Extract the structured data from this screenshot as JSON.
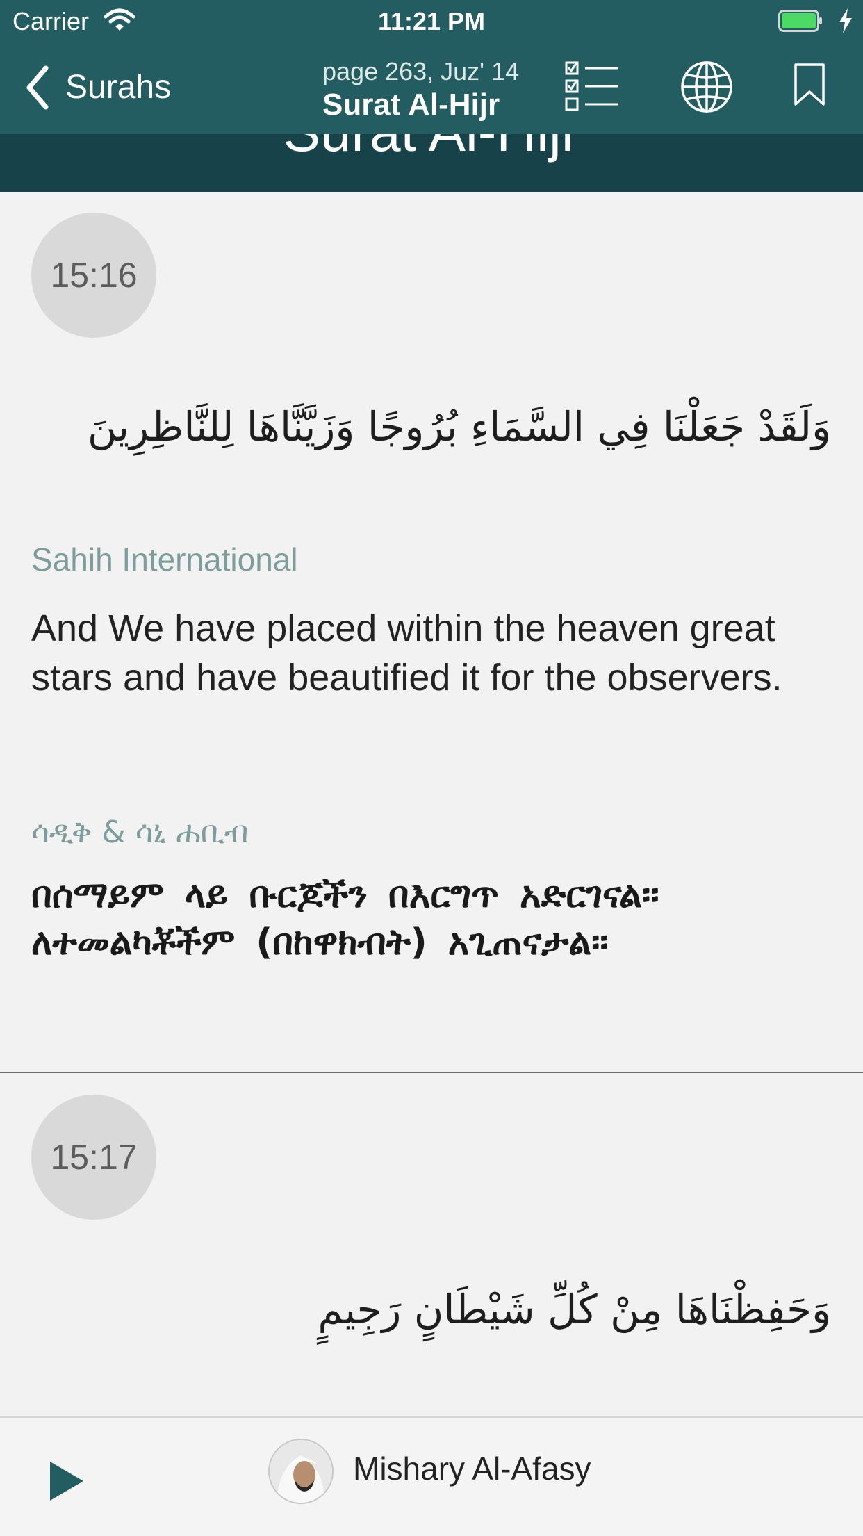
{
  "status_bar": {
    "carrier": "Carrier",
    "time": "11:21 PM"
  },
  "nav": {
    "back_label": "Surahs",
    "subtitle": "page 263, Juz' 14",
    "title": "Surat Al-Hijr"
  },
  "surah_banner": {
    "title": "Surat Al-Hijr"
  },
  "verses": [
    {
      "number": "15:16",
      "arabic": "وَلَقَدْ جَعَلْنَا فِي السَّمَاءِ بُرُوجًا وَزَيَّنَّاهَا لِلنَّاظِرِينَ",
      "translation_name": "Sahih International",
      "translation_text": "And We have placed within the heaven great stars and have beautified it for the observers.",
      "translation2_name": "ሳዲቅ & ሳኒ ሐቢብ",
      "translation2_text": "በሰማይም ላይ ቡርጆችን በእርግጥ አድርገናል፡፡ ለተመልካቾችም (በከዋክብት) አጊጠናታል፡፡"
    },
    {
      "number": "15:17",
      "arabic": "وَحَفِظْنَاهَا مِنْ كُلِّ شَيْطَانٍ رَجِيمٍ"
    }
  ],
  "player": {
    "reciter": "Mishary Al-Afasy"
  },
  "colors": {
    "header": "#235d61",
    "banner": "#18424a",
    "accent_label": "#7d9c9c",
    "battery": "#4cd964",
    "play": "#235d61"
  },
  "icons": [
    "wifi-icon",
    "battery-icon",
    "charging-bolt-icon",
    "back-chevron-icon",
    "checklist-icon",
    "globe-icon",
    "bookmark-icon",
    "play-icon"
  ]
}
